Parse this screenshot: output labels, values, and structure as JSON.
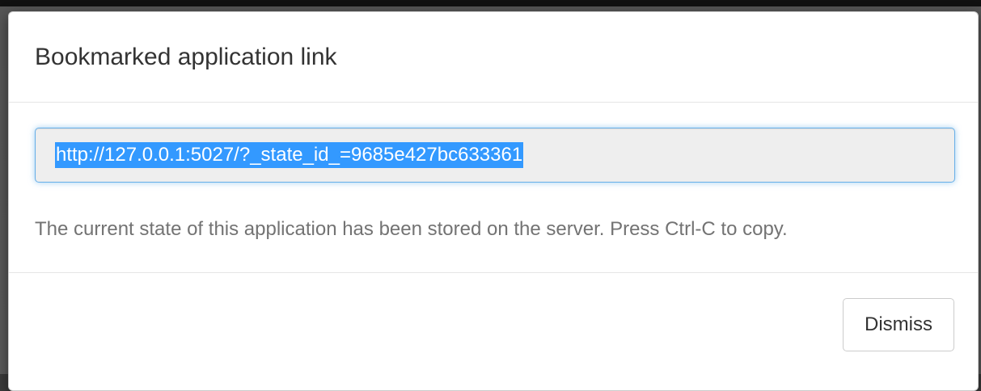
{
  "modal": {
    "title": "Bookmarked application link",
    "url_value": "http://127.0.0.1:5027/?_state_id_=9685e427bc633361",
    "help_text": "The current state of this application has been stored on the server. Press Ctrl-C to copy.",
    "dismiss_label": "Dismiss"
  },
  "colors": {
    "selection_bg": "#3399ff",
    "focus_border": "#66afe9",
    "input_bg": "#eeeeee"
  }
}
